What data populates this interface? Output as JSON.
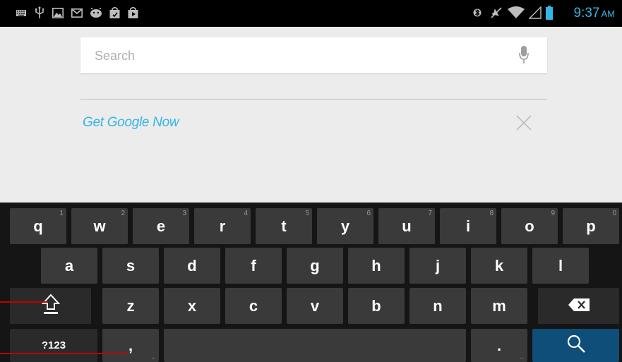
{
  "status_bar": {
    "time": "9:37",
    "ampm": "AM",
    "left_icons": [
      "keyboard-icon",
      "usb-icon",
      "image-icon",
      "gmail-icon",
      "android-icon",
      "shopping-bag-icon",
      "play-store-icon"
    ],
    "right_icons": [
      "bluetooth-icon",
      "mute-icon",
      "wifi-icon",
      "signal-icon",
      "battery-icon"
    ]
  },
  "search": {
    "placeholder": "Search",
    "value": ""
  },
  "google_now": {
    "label": "Get Google Now"
  },
  "keyboard": {
    "row1": [
      {
        "label": "q",
        "hint": "1"
      },
      {
        "label": "w",
        "hint": "2"
      },
      {
        "label": "e",
        "hint": "3"
      },
      {
        "label": "r",
        "hint": "4"
      },
      {
        "label": "t",
        "hint": "5"
      },
      {
        "label": "y",
        "hint": "6"
      },
      {
        "label": "u",
        "hint": "7"
      },
      {
        "label": "i",
        "hint": "8"
      },
      {
        "label": "o",
        "hint": "9"
      },
      {
        "label": "p",
        "hint": "0"
      }
    ],
    "row2": [
      "a",
      "s",
      "d",
      "f",
      "g",
      "h",
      "j",
      "k",
      "l"
    ],
    "row3": [
      "z",
      "x",
      "c",
      "v",
      "b",
      "n",
      "m"
    ],
    "symbols_label": "?123",
    "comma_label": ",",
    "period_label": ".",
    "comma_hint": "...",
    "period_hint": "..."
  },
  "colors": {
    "accent": "#33b5e5",
    "keyboard_bg": "#151515",
    "key_bg": "#3a3a3a",
    "search_key_bg": "#0f4e78",
    "annotation": "#c00000"
  }
}
